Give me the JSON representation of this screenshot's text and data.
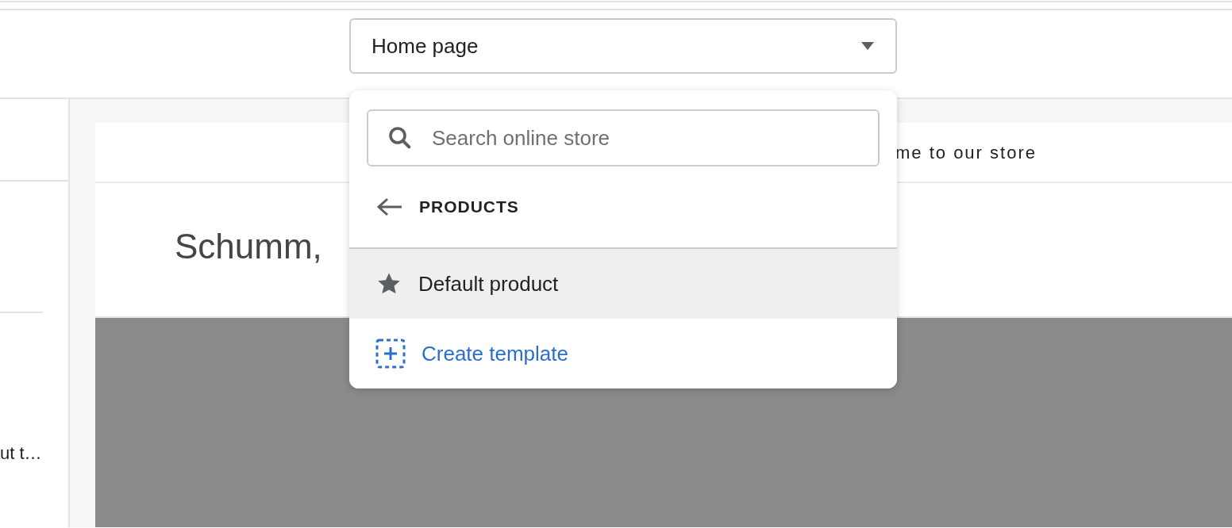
{
  "page_selector": {
    "value": "Home page"
  },
  "preview": {
    "announcement": "me to our store",
    "heading": "Schumm,",
    "image": {
      "kind": "placeholder"
    }
  },
  "sidebar": {
    "snippet": "ut t…"
  },
  "dropdown": {
    "search": {
      "placeholder": "Search online store"
    },
    "section": "PRODUCTS",
    "items": [
      {
        "kind": "template",
        "label": "Default product",
        "selected": true
      },
      {
        "kind": "create",
        "label": "Create template",
        "selected": false
      }
    ]
  }
}
